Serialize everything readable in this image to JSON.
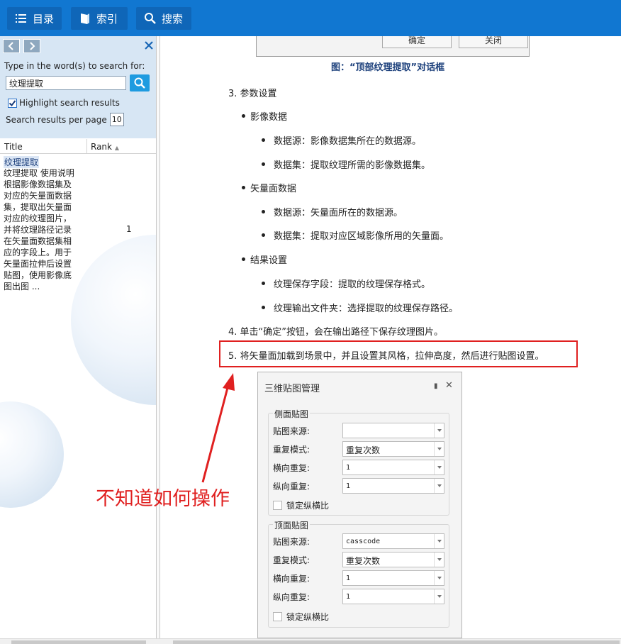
{
  "toolbar": {
    "toc_label": "目录",
    "index_label": "索引",
    "search_label": "搜索",
    "bg_color": "#1177d1"
  },
  "search_panel": {
    "prompt": "Type in the word(s) to search for:",
    "query": "纹理提取",
    "highlight_label": "Highlight search results",
    "highlight_checked": true,
    "per_page_label": "Search results per page",
    "per_page_value": "10",
    "col_title": "Title",
    "col_rank": "Rank",
    "results": [
      {
        "title": "纹理提取",
        "desc": "纹理提取 使用说明 根据影像数据集及 对应的矢量面数据 集，提取出矢量面 对应的纹理图片， 并将纹理路径记录 在矢量面数据集相 应的字段上。用于 矢量面拉伸后设置 贴图，使用影像底 图出图 ...",
        "rank": "1"
      }
    ]
  },
  "document": {
    "top_dialog": {
      "ok_label": "确定",
      "close_label": "关闭"
    },
    "caption": "图：“顶部纹理提取”对话框",
    "step3": "3. 参数设置",
    "image_data": "影像数据",
    "image_ds": "数据源：影像数据集所在的数据源。",
    "image_dset": "数据集：提取纹理所需的影像数据集。",
    "vector_data": "矢量面数据",
    "vector_ds": "数据源：矢量面所在的数据源。",
    "vector_dset": "数据集：提取对应区域影像所用的矢量面。",
    "result_settings": "结果设置",
    "tex_field": "纹理保存字段：提取的纹理保存格式。",
    "tex_folder": "纹理输出文件夹：选择提取的纹理保存路径。",
    "step4": "4. 单击“确定”按钮，会在输出路径下保存纹理图片。",
    "step5": "5. 将矢量面加载到场景中，并且设置其风格，拉伸高度，然后进行贴图设置。"
  },
  "texture_dialog": {
    "title": "三维贴图管理",
    "pin_icon": "pin-icon",
    "side_group": "侧面贴图",
    "top_group": "顶面贴图",
    "label_source": "贴图来源:",
    "label_mode": "重复模式:",
    "label_h": "横向重复:",
    "label_v": "纵向重复:",
    "lock_label": "锁定纵横比",
    "side": {
      "source": "",
      "mode": "重复次数",
      "h": "1",
      "v": "1"
    },
    "top": {
      "source": "casscode",
      "mode": "重复次数",
      "h": "1",
      "v": "1"
    }
  },
  "annotation": {
    "text": "不知道如何操作",
    "color": "#e02020"
  }
}
